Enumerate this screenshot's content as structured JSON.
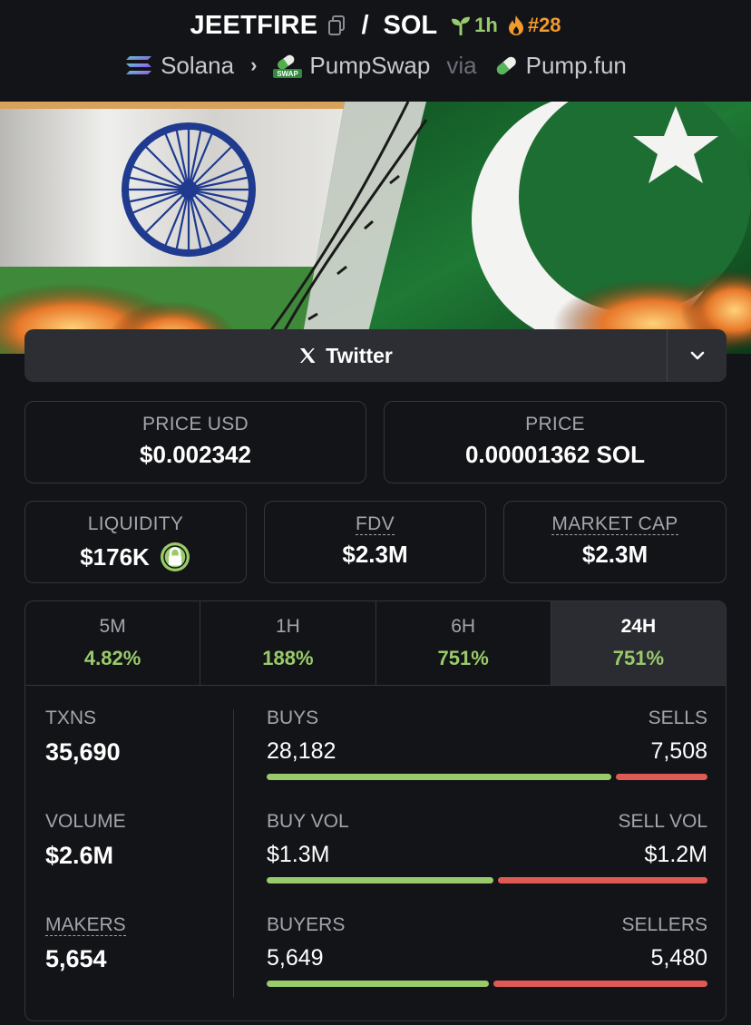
{
  "header": {
    "token": "JEETFIRE",
    "slash": "/",
    "quote": "SOL",
    "age": "1h",
    "rank": "#28",
    "chain": "Solana",
    "dex": "PumpSwap",
    "via": "via",
    "launchpad": "Pump.fun",
    "swap_badge": "SWAP"
  },
  "socials": {
    "twitter_label": "Twitter"
  },
  "price": {
    "usd_label": "PRICE USD",
    "usd_value": "$0.002342",
    "native_label": "PRICE",
    "native_value": "0.00001362 SOL"
  },
  "metrics": {
    "liquidity_label": "LIQUIDITY",
    "liquidity_value": "$176K",
    "fdv_label": "FDV",
    "fdv_value": "$2.3M",
    "mcap_label": "MARKET CAP",
    "mcap_value": "$2.3M"
  },
  "timeframes": [
    {
      "label": "5M",
      "change": "4.82%"
    },
    {
      "label": "1H",
      "change": "188%"
    },
    {
      "label": "6H",
      "change": "751%"
    },
    {
      "label": "24H",
      "change": "751%"
    }
  ],
  "active_timeframe": "24H",
  "stats": {
    "txns_label": "TXNS",
    "txns_value": "35,690",
    "volume_label": "VOLUME",
    "volume_value": "$2.6M",
    "makers_label": "MAKERS",
    "makers_value": "5,654",
    "buys_label": "BUYS",
    "buys_value": "28,182",
    "sells_label": "SELLS",
    "sells_value": "7,508",
    "buys_fraction": 0.79,
    "buy_vol_label": "BUY VOL",
    "buy_vol_value": "$1.3M",
    "sell_vol_label": "SELL VOL",
    "sell_vol_value": "$1.2M",
    "buy_vol_fraction": 0.52,
    "buyers_label": "BUYERS",
    "buyers_value": "5,649",
    "sellers_label": "SELLERS",
    "sellers_value": "5,480",
    "buyers_fraction": 0.51
  },
  "colors": {
    "positive": "#9acb6b",
    "negative": "#e05a55",
    "rank": "#f29a2e",
    "background": "#131418"
  }
}
